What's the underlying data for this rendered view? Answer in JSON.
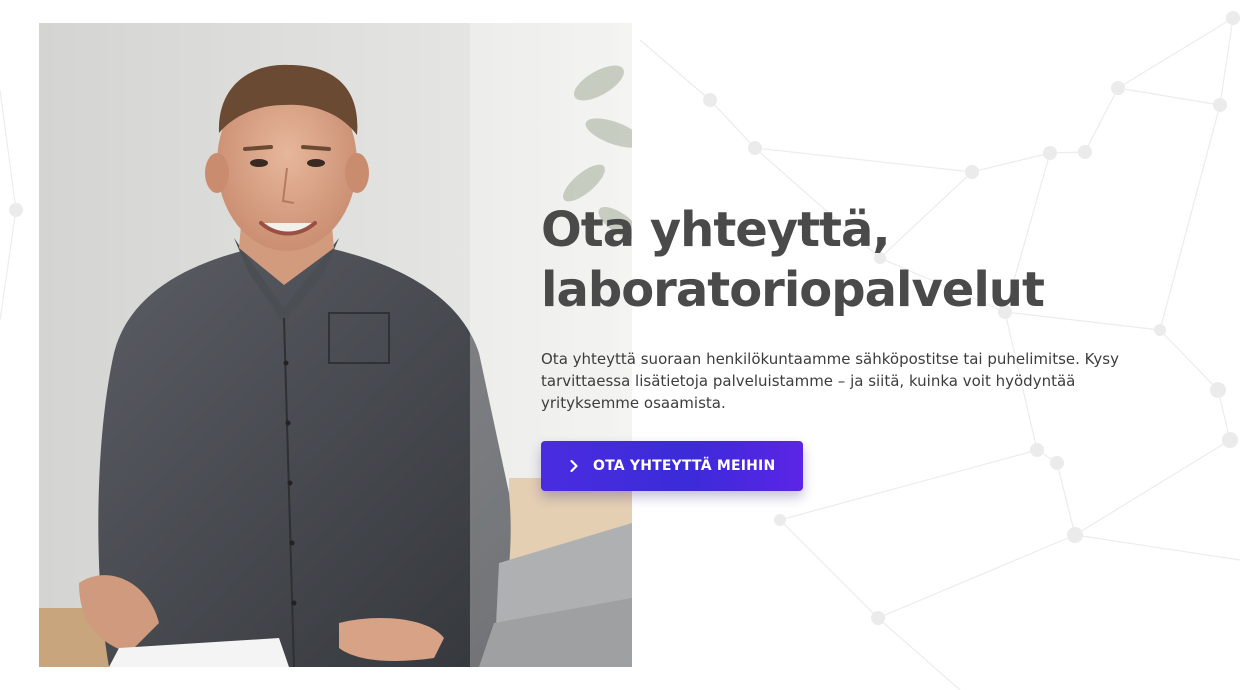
{
  "hero": {
    "heading_line1": "Ota yhteyttä,",
    "heading_line2": "laboratoriopalvelut",
    "body": "Ota yhteyttä suoraan henkilökuntaamme sähköpostitse tai puhelimitse. Kysy tarvittaessa lisätietoja palveluistamme – ja siitä, kuinka voit hyödyntää yrityksemme osaamista.",
    "cta_label": "OTA YHTEYTTÄ MEIHIN",
    "cta_icon": "chevron-right-icon"
  },
  "photo": {
    "subject": "staff-portrait"
  },
  "colors": {
    "heading": "#4a4a4a",
    "body": "#3d3d3d",
    "cta_start": "#4a2ce0",
    "cta_end": "#5b25e6",
    "network": "#e6e6e6"
  }
}
